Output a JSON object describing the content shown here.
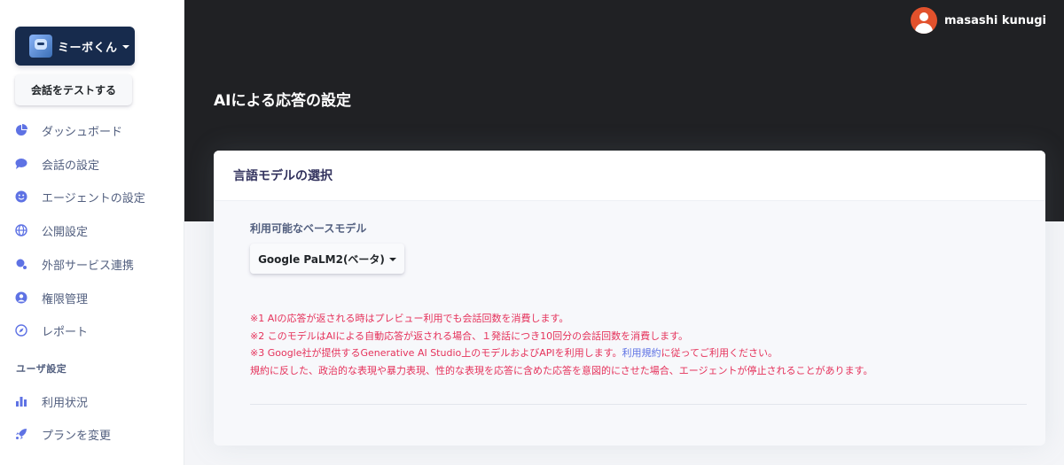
{
  "sidebar": {
    "agent_name": "ミーボくん",
    "test_button": "会話をテストする",
    "items": [
      {
        "label": "ダッシュボード",
        "icon": "pie-chart-icon"
      },
      {
        "label": "会話の設定",
        "icon": "chat-bubble-icon"
      },
      {
        "label": "エージェントの設定",
        "icon": "smiley-icon"
      },
      {
        "label": "公開設定",
        "icon": "globe-icon"
      },
      {
        "label": "外部サービス連携",
        "icon": "planet-icon"
      },
      {
        "label": "権限管理",
        "icon": "user-circle-icon"
      },
      {
        "label": "レポート",
        "icon": "compass-icon"
      }
    ],
    "user_section_heading": "ユーザ設定",
    "user_items": [
      {
        "label": "利用状況",
        "icon": "bar-chart-icon"
      },
      {
        "label": "プランを変更",
        "icon": "rocket-icon"
      }
    ]
  },
  "header": {
    "user_name": "masashi kunugi",
    "page_title": "AIによる応答の設定"
  },
  "card": {
    "title": "言語モデルの選択",
    "field_label": "利用可能なベースモデル",
    "model_selected": "Google PaLM2(ベータ)",
    "notes": {
      "n1": "※1 AIの応答が返される時はプレビュー利用でも会話回数を消費します。",
      "n2": "※2 このモデルはAIによる自動応答が返される場合、１発話につき10回分の会話回数を消費します。",
      "n3_before": "※3 Google社が提供するGenerative AI Studio上のモデルおよびAPIを利用します。",
      "n3_link": "利用規約",
      "n3_after": "に従ってご利用ください。",
      "n4": "規約に反した、政治的な表現や暴力表現、性的な表現を応答に含めた応答を意図的にさせた場合、エージェントが停止されることがあります。"
    }
  },
  "colors": {
    "accent_blue": "#5e72e4",
    "sidebar_icon": "#5e72e4",
    "note_red": "#e5325b",
    "header_bg": "#202124",
    "agent_button_bg": "#172b4d"
  }
}
